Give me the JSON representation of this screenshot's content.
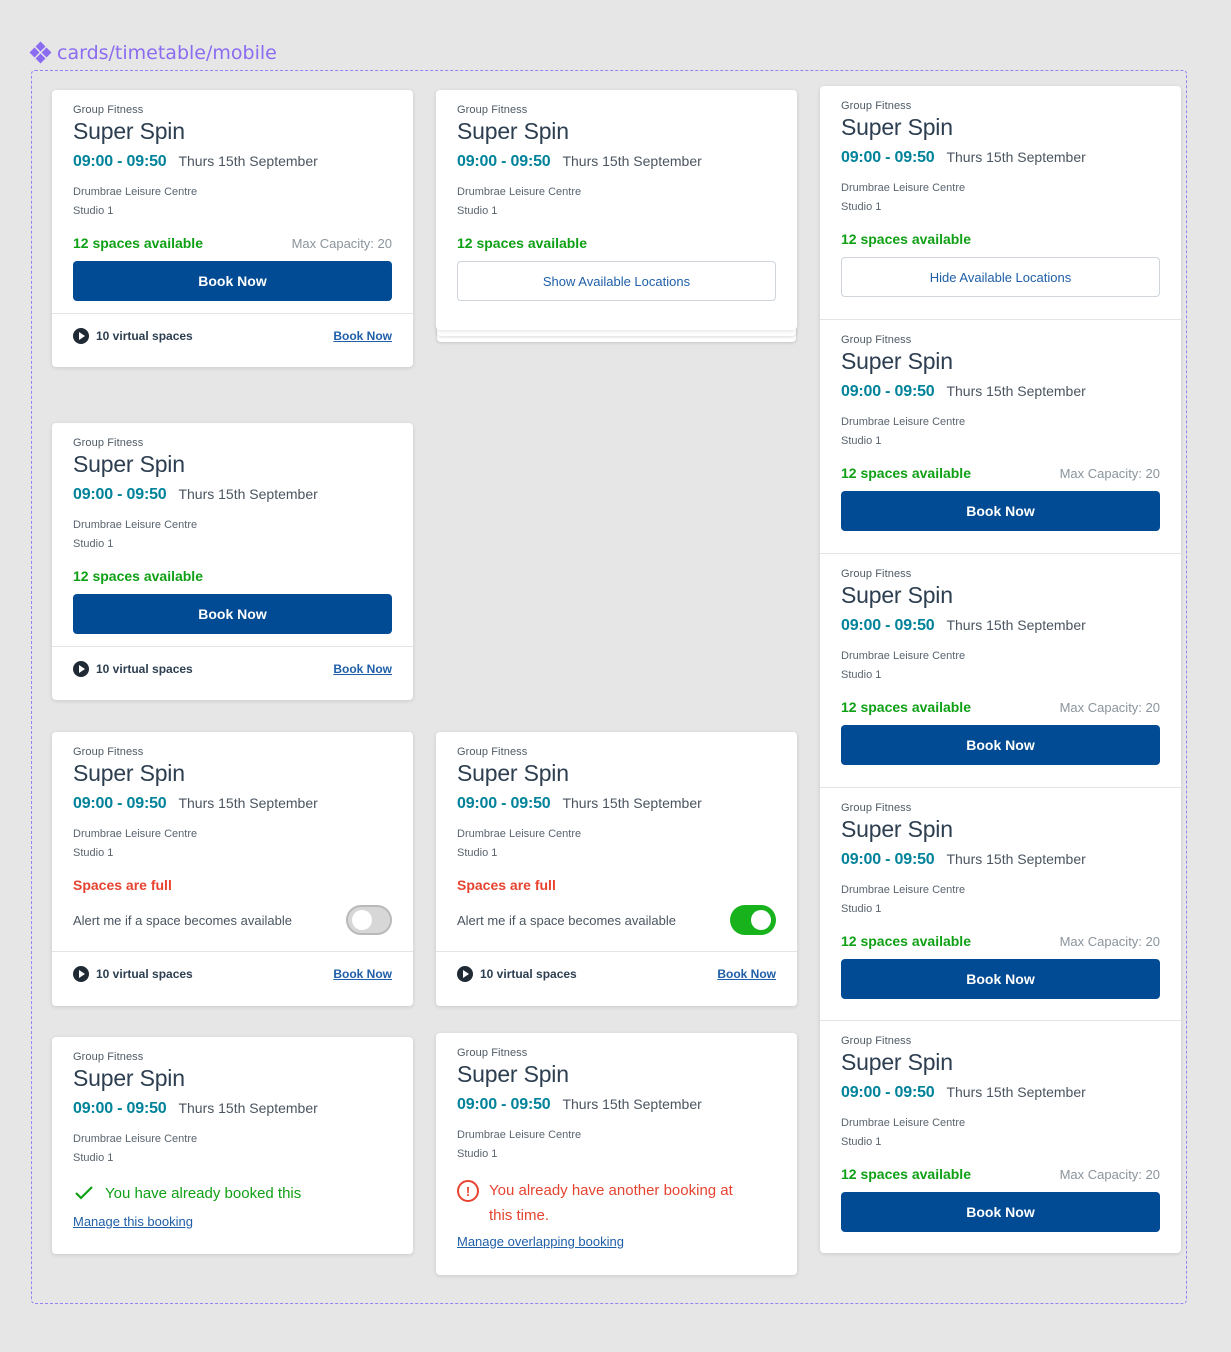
{
  "frame": {
    "label": "cards/timetable/mobile",
    "accent": "#8b6cf0"
  },
  "class": {
    "category": "Group Fitness",
    "name": "Super Spin",
    "time": "09:00 - 09:50",
    "date": "Thurs 15th September",
    "venue": "Drumbrae Leisure Centre",
    "room": "Studio 1"
  },
  "labels": {
    "spaces_available": "12 spaces available",
    "max_capacity": "Max Capacity: 20",
    "book_now": "Book Now",
    "show_locations": "Show Available Locations",
    "hide_locations": "Hide Available Locations",
    "virtual_spaces": "10 virtual spaces",
    "book_now_link": "Book Now",
    "spaces_full": "Spaces are full",
    "alert_me": "Alert me if a space becomes available",
    "already_booked": "You have already booked this",
    "manage_booking": "Manage this booking",
    "overlap_error": "You already have another booking at this time.",
    "manage_overlap": "Manage overlapping booking"
  },
  "toggles": {
    "alert_card_left": false,
    "alert_card_right": true
  },
  "colors": {
    "primary": "#004b93",
    "teal_time": "#00839a",
    "success": "#10a016",
    "error": "#e64431",
    "toggle_on": "#17b21c"
  }
}
